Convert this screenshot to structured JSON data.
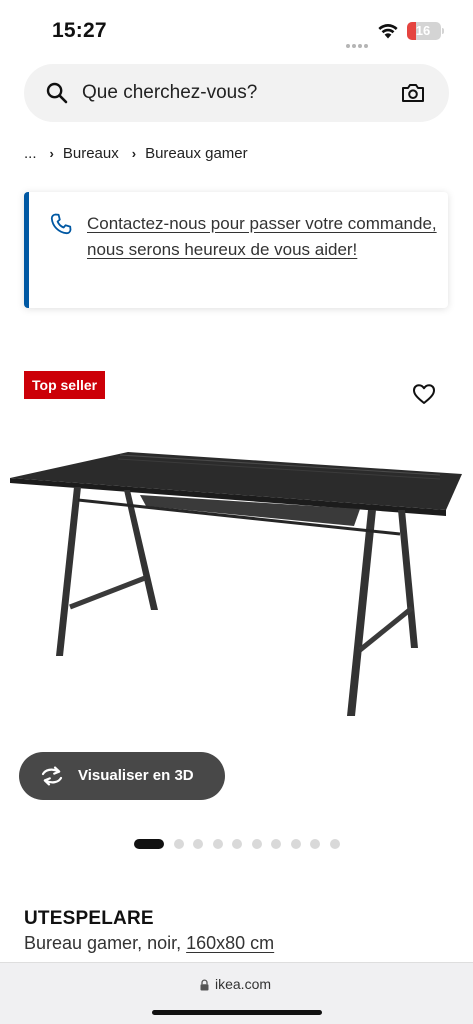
{
  "status_bar": {
    "time": "15:27",
    "battery_level": "16",
    "battery_color": "#e5443f"
  },
  "search": {
    "placeholder": "Que cherchez-vous?",
    "icons": [
      "search-icon",
      "camera-icon"
    ]
  },
  "breadcrumb": {
    "items": [
      "...",
      "Bureaux",
      "Bureaux gamer"
    ]
  },
  "contact": {
    "text": "Contactez-nous pour passer votre commande, nous serons heureux de vous aider!",
    "icon": "phone-icon",
    "accent_color": "#0058a3"
  },
  "product": {
    "badge": "Top seller",
    "badge_color": "#cc0008",
    "favorite_icon": "heart-icon",
    "view_3d_label": "Visualiser en 3D",
    "carousel": {
      "total_images": 10,
      "active_index": 0
    },
    "name": "UTESPELARE",
    "description": "Bureau gamer, noir,",
    "size": "160x80 cm"
  },
  "browser": {
    "url": "ikea.com"
  }
}
